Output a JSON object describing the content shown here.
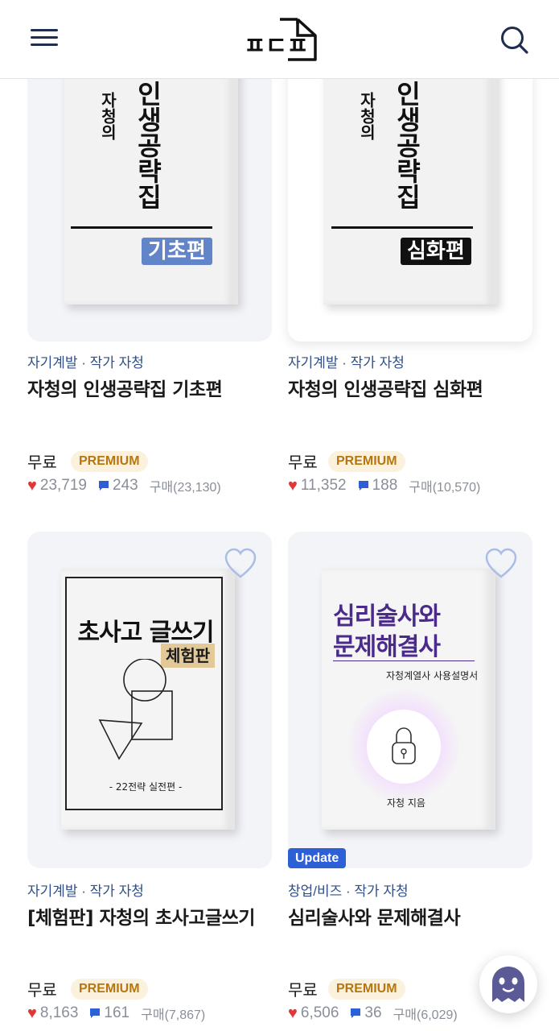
{
  "header": {
    "logo_text": "ㅍㄷㅍ",
    "icons": {
      "menu": "hamburger-menu-icon",
      "search": "search-icon"
    }
  },
  "colors": {
    "category": "#2f4f86",
    "premium_bg": "#fbf1dc",
    "premium_text": "#b5770e",
    "heart": "#e03838",
    "update_badge": "#2d60d6"
  },
  "products": [
    {
      "cover": {
        "author_line": "자청의",
        "title_line": "인생공략집",
        "edition": "기초편"
      },
      "category": "자기계발 · 작가 자청",
      "title": "자청의 인생공략집 기초편",
      "price": "무료",
      "badge": "PREMIUM",
      "likes": "23,719",
      "comments": "243",
      "purchases": "구매(23,130)"
    },
    {
      "cover": {
        "author_line": "자청의",
        "title_line": "인생공략집",
        "edition": "심화편"
      },
      "category": "자기계발 · 작가 자청",
      "title": "자청의 인생공략집 심화편",
      "price": "무료",
      "badge": "PREMIUM",
      "likes": "11,352",
      "comments": "188",
      "purchases": "구매(10,570)"
    },
    {
      "cover": {
        "title_line": "초사고 글쓰기",
        "edition": "체험판",
        "footer": "- 22전략 실전편 -"
      },
      "category": "자기계발 · 작가 자청",
      "title": "[체험판] 자청의 초사고글쓰기",
      "price": "무료",
      "badge": "PREMIUM",
      "likes": "8,163",
      "comments": "161",
      "purchases": "구매(7,867)"
    },
    {
      "cover": {
        "title_line1": "심리술사와",
        "title_line2": "문제해결사",
        "subtitle": "자청계열사 사용설명서",
        "author": "자청 지음"
      },
      "update": "Update",
      "category": "창업/비즈 · 작가 자청",
      "title": "심리술사와 문제해결사",
      "price": "무료",
      "badge": "PREMIUM",
      "likes": "6,506",
      "comments": "36",
      "purchases": "구매(6,029)"
    }
  ]
}
